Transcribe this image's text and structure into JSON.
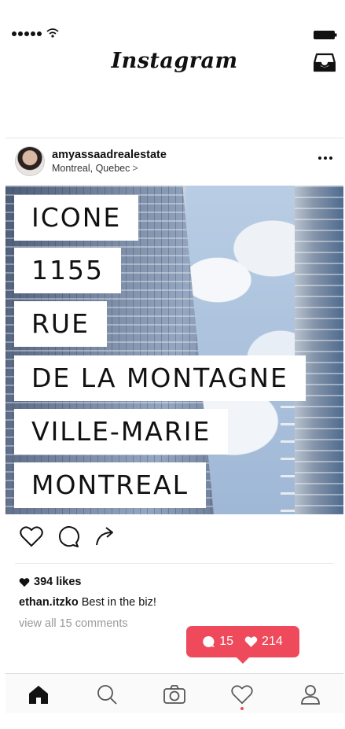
{
  "app": {
    "title": "Instagram"
  },
  "post": {
    "username": "amyassaadrealestate",
    "location": "Montreal, Quebec",
    "location_chevron": ">",
    "image_caption_lines": [
      "ICONE",
      "1155",
      "RUE",
      "DE LA MONTAGNE",
      "VILLE-MARIE",
      "MONTREAL"
    ],
    "likes": "394 likes",
    "comment": {
      "user": "ethan.itzko",
      "text": "Best in the biz!"
    },
    "view_all_comments": "view all 15 comments"
  },
  "notification": {
    "comments": "15",
    "likes": "214"
  },
  "colors": {
    "accent": "#ee4a5c"
  },
  "icons": {
    "status": [
      "signal-icon",
      "wifi-icon",
      "battery-icon"
    ],
    "header": [
      "inbox-icon"
    ],
    "actions": [
      "heart-icon",
      "comment-icon",
      "share-icon"
    ],
    "tabs": [
      "home-icon",
      "search-icon",
      "camera-icon",
      "activity-heart-icon",
      "profile-icon"
    ]
  }
}
